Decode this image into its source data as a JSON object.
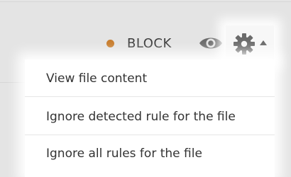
{
  "status": {
    "label": "BLOCK",
    "dot_color": "#c77b2a"
  },
  "toolbar": {
    "eye_icon": "eye-icon",
    "gear_icon": "gear-icon",
    "caret_icon": "caret-up-icon"
  },
  "menu": {
    "items": [
      {
        "label": "View file content"
      },
      {
        "label": "Ignore detected rule for the file"
      },
      {
        "label": "Ignore all rules for the file"
      }
    ]
  }
}
